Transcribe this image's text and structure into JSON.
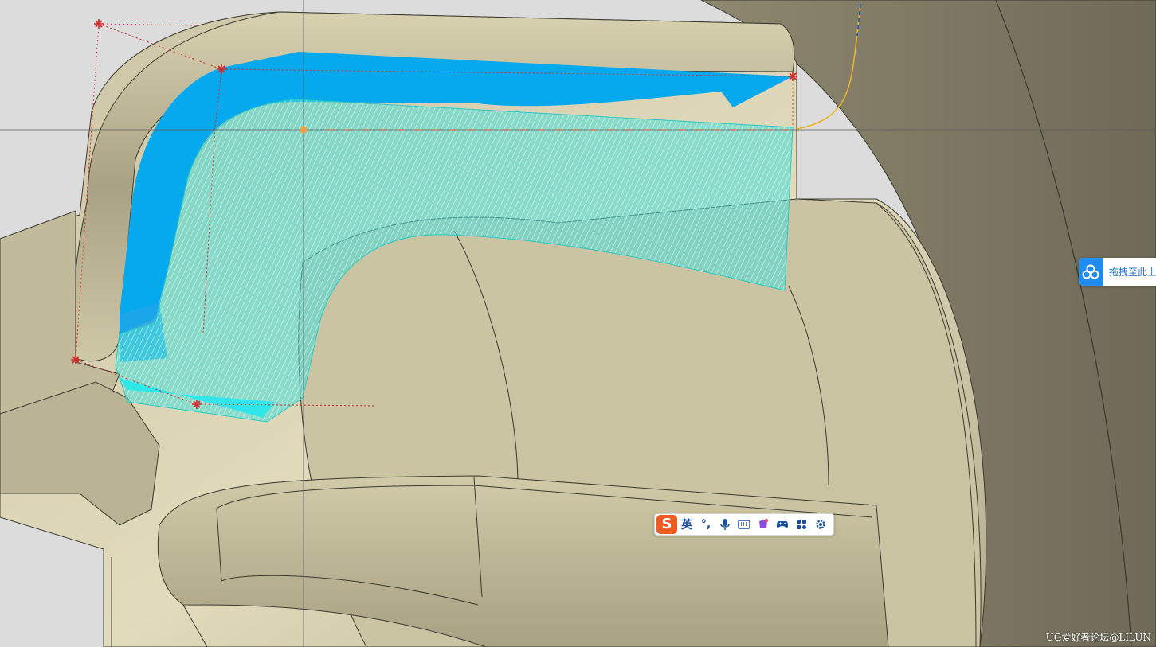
{
  "ime_toolbar": {
    "logo": "S",
    "mode": "英",
    "punctuation": "°,",
    "icons": [
      "microphone-icon",
      "keyboard-icon",
      "skin-icon",
      "gamepad-icon",
      "apps-grid-icon",
      "settings-gear-icon"
    ]
  },
  "drag_widget": {
    "icon": "cloud-circles-icon",
    "label": "拖拽至此上传"
  },
  "watermark": "UG爱好者论坛@LILUN",
  "colors": {
    "model_surface": "#bdb596",
    "model_dark": "#797462",
    "toolpath_blue": "#06a8ee",
    "toolpath_cyan": "#44ddd8",
    "marker_red": "#d42a2a",
    "path_yellow": "#e8b22a",
    "ime_orange": "#ee5a24",
    "drag_blue": "#1e8cf0"
  }
}
